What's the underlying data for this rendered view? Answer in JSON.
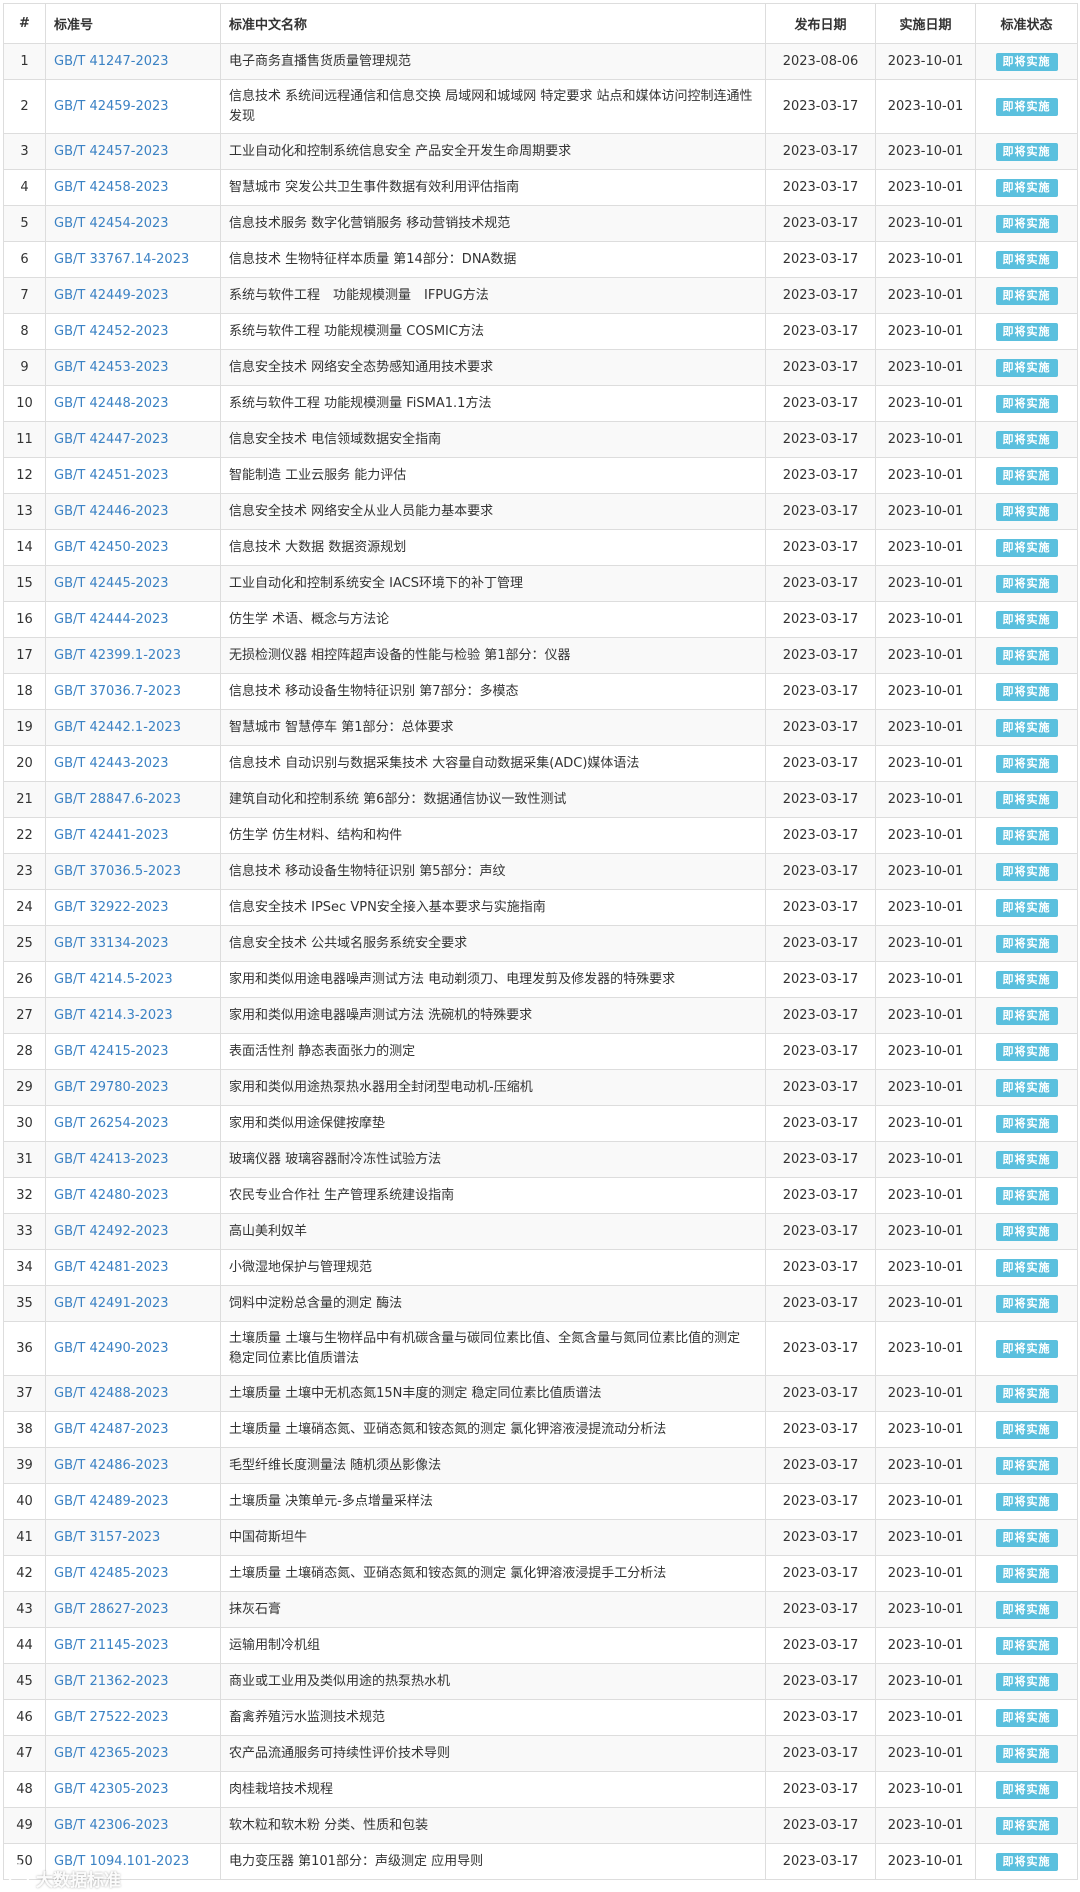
{
  "table": {
    "headers": [
      "#",
      "标准号",
      "标准中文名称",
      "发布日期",
      "实施日期",
      "标准状态"
    ],
    "rows": [
      {
        "no": "1",
        "code": "GB/T 41247-2023",
        "name": "电子商务直播售货质量管理规范",
        "published": "2023-08-06",
        "effective": "2023-10-01",
        "status": "即将实施"
      },
      {
        "no": "2",
        "code": "GB/T 42459-2023",
        "name": "信息技术 系统间远程通信和信息交换 局域网和城域网 特定要求 站点和媒体访问控制连通性发现",
        "published": "2023-03-17",
        "effective": "2023-10-01",
        "status": "即将实施"
      },
      {
        "no": "3",
        "code": "GB/T 42457-2023",
        "name": "工业自动化和控制系统信息安全 产品安全开发生命周期要求",
        "published": "2023-03-17",
        "effective": "2023-10-01",
        "status": "即将实施"
      },
      {
        "no": "4",
        "code": "GB/T 42458-2023",
        "name": "智慧城市 突发公共卫生事件数据有效利用评估指南",
        "published": "2023-03-17",
        "effective": "2023-10-01",
        "status": "即将实施"
      },
      {
        "no": "5",
        "code": "GB/T 42454-2023",
        "name": "信息技术服务 数字化营销服务 移动营销技术规范",
        "published": "2023-03-17",
        "effective": "2023-10-01",
        "status": "即将实施"
      },
      {
        "no": "6",
        "code": "GB/T 33767.14-2023",
        "name": "信息技术 生物特征样本质量 第14部分：DNA数据",
        "published": "2023-03-17",
        "effective": "2023-10-01",
        "status": "即将实施"
      },
      {
        "no": "7",
        "code": "GB/T 42449-2023",
        "name": "系统与软件工程　功能规模测量　IFPUG方法",
        "published": "2023-03-17",
        "effective": "2023-10-01",
        "status": "即将实施"
      },
      {
        "no": "8",
        "code": "GB/T 42452-2023",
        "name": "系统与软件工程 功能规模测量 COSMIC方法",
        "published": "2023-03-17",
        "effective": "2023-10-01",
        "status": "即将实施"
      },
      {
        "no": "9",
        "code": "GB/T 42453-2023",
        "name": "信息安全技术 网络安全态势感知通用技术要求",
        "published": "2023-03-17",
        "effective": "2023-10-01",
        "status": "即将实施"
      },
      {
        "no": "10",
        "code": "GB/T 42448-2023",
        "name": "系统与软件工程 功能规模测量 FiSMA1.1方法",
        "published": "2023-03-17",
        "effective": "2023-10-01",
        "status": "即将实施"
      },
      {
        "no": "11",
        "code": "GB/T 42447-2023",
        "name": "信息安全技术 电信领域数据安全指南",
        "published": "2023-03-17",
        "effective": "2023-10-01",
        "status": "即将实施"
      },
      {
        "no": "12",
        "code": "GB/T 42451-2023",
        "name": "智能制造 工业云服务 能力评估",
        "published": "2023-03-17",
        "effective": "2023-10-01",
        "status": "即将实施"
      },
      {
        "no": "13",
        "code": "GB/T 42446-2023",
        "name": "信息安全技术 网络安全从业人员能力基本要求",
        "published": "2023-03-17",
        "effective": "2023-10-01",
        "status": "即将实施"
      },
      {
        "no": "14",
        "code": "GB/T 42450-2023",
        "name": "信息技术 大数据 数据资源规划",
        "published": "2023-03-17",
        "effective": "2023-10-01",
        "status": "即将实施"
      },
      {
        "no": "15",
        "code": "GB/T 42445-2023",
        "name": "工业自动化和控制系统安全 IACS环境下的补丁管理",
        "published": "2023-03-17",
        "effective": "2023-10-01",
        "status": "即将实施"
      },
      {
        "no": "16",
        "code": "GB/T 42444-2023",
        "name": "仿生学 术语、概念与方法论",
        "published": "2023-03-17",
        "effective": "2023-10-01",
        "status": "即将实施"
      },
      {
        "no": "17",
        "code": "GB/T 42399.1-2023",
        "name": "无损检测仪器 相控阵超声设备的性能与检验 第1部分：仪器",
        "published": "2023-03-17",
        "effective": "2023-10-01",
        "status": "即将实施"
      },
      {
        "no": "18",
        "code": "GB/T 37036.7-2023",
        "name": "信息技术 移动设备生物特征识别 第7部分：多模态",
        "published": "2023-03-17",
        "effective": "2023-10-01",
        "status": "即将实施"
      },
      {
        "no": "19",
        "code": "GB/T 42442.1-2023",
        "name": "智慧城市 智慧停车 第1部分：总体要求",
        "published": "2023-03-17",
        "effective": "2023-10-01",
        "status": "即将实施"
      },
      {
        "no": "20",
        "code": "GB/T 42443-2023",
        "name": "信息技术 自动识别与数据采集技术 大容量自动数据采集(ADC)媒体语法",
        "published": "2023-03-17",
        "effective": "2023-10-01",
        "status": "即将实施"
      },
      {
        "no": "21",
        "code": "GB/T 28847.6-2023",
        "name": "建筑自动化和控制系统 第6部分：数据通信协议一致性测试",
        "published": "2023-03-17",
        "effective": "2023-10-01",
        "status": "即将实施"
      },
      {
        "no": "22",
        "code": "GB/T 42441-2023",
        "name": "仿生学 仿生材料、结构和构件",
        "published": "2023-03-17",
        "effective": "2023-10-01",
        "status": "即将实施"
      },
      {
        "no": "23",
        "code": "GB/T 37036.5-2023",
        "name": "信息技术 移动设备生物特征识别 第5部分：声纹",
        "published": "2023-03-17",
        "effective": "2023-10-01",
        "status": "即将实施"
      },
      {
        "no": "24",
        "code": "GB/T 32922-2023",
        "name": "信息安全技术 IPSec VPN安全接入基本要求与实施指南",
        "published": "2023-03-17",
        "effective": "2023-10-01",
        "status": "即将实施"
      },
      {
        "no": "25",
        "code": "GB/T 33134-2023",
        "name": "信息安全技术 公共域名服务系统安全要求",
        "published": "2023-03-17",
        "effective": "2023-10-01",
        "status": "即将实施"
      },
      {
        "no": "26",
        "code": "GB/T 4214.5-2023",
        "name": "家用和类似用途电器噪声测试方法 电动剃须刀、电理发剪及修发器的特殊要求",
        "published": "2023-03-17",
        "effective": "2023-10-01",
        "status": "即将实施"
      },
      {
        "no": "27",
        "code": "GB/T 4214.3-2023",
        "name": "家用和类似用途电器噪声测试方法 洗碗机的特殊要求",
        "published": "2023-03-17",
        "effective": "2023-10-01",
        "status": "即将实施"
      },
      {
        "no": "28",
        "code": "GB/T 42415-2023",
        "name": "表面活性剂 静态表面张力的测定",
        "published": "2023-03-17",
        "effective": "2023-10-01",
        "status": "即将实施"
      },
      {
        "no": "29",
        "code": "GB/T 29780-2023",
        "name": "家用和类似用途热泵热水器用全封闭型电动机-压缩机",
        "published": "2023-03-17",
        "effective": "2023-10-01",
        "status": "即将实施"
      },
      {
        "no": "30",
        "code": "GB/T 26254-2023",
        "name": "家用和类似用途保健按摩垫",
        "published": "2023-03-17",
        "effective": "2023-10-01",
        "status": "即将实施"
      },
      {
        "no": "31",
        "code": "GB/T 42413-2023",
        "name": "玻璃仪器 玻璃容器耐冷冻性试验方法",
        "published": "2023-03-17",
        "effective": "2023-10-01",
        "status": "即将实施"
      },
      {
        "no": "32",
        "code": "GB/T 42480-2023",
        "name": "农民专业合作社 生产管理系统建设指南",
        "published": "2023-03-17",
        "effective": "2023-10-01",
        "status": "即将实施"
      },
      {
        "no": "33",
        "code": "GB/T 42492-2023",
        "name": "高山美利奴羊",
        "published": "2023-03-17",
        "effective": "2023-10-01",
        "status": "即将实施"
      },
      {
        "no": "34",
        "code": "GB/T 42481-2023",
        "name": "小微湿地保护与管理规范",
        "published": "2023-03-17",
        "effective": "2023-10-01",
        "status": "即将实施"
      },
      {
        "no": "35",
        "code": "GB/T 42491-2023",
        "name": "饲料中淀粉总含量的测定 酶法",
        "published": "2023-03-17",
        "effective": "2023-10-01",
        "status": "即将实施"
      },
      {
        "no": "36",
        "code": "GB/T 42490-2023",
        "name": "土壤质量 土壤与生物样品中有机碳含量与碳同位素比值、全氮含量与氮同位素比值的测定 稳定同位素比值质谱法",
        "published": "2023-03-17",
        "effective": "2023-10-01",
        "status": "即将实施"
      },
      {
        "no": "37",
        "code": "GB/T 42488-2023",
        "name": "土壤质量 土壤中无机态氮15N丰度的测定 稳定同位素比值质谱法",
        "published": "2023-03-17",
        "effective": "2023-10-01",
        "status": "即将实施"
      },
      {
        "no": "38",
        "code": "GB/T 42487-2023",
        "name": "土壤质量 土壤硝态氮、亚硝态氮和铵态氮的测定 氯化钾溶液浸提流动分析法",
        "published": "2023-03-17",
        "effective": "2023-10-01",
        "status": "即将实施"
      },
      {
        "no": "39",
        "code": "GB/T 42486-2023",
        "name": "毛型纤维长度测量法 随机须丛影像法",
        "published": "2023-03-17",
        "effective": "2023-10-01",
        "status": "即将实施"
      },
      {
        "no": "40",
        "code": "GB/T 42489-2023",
        "name": "土壤质量 决策单元-多点增量采样法",
        "published": "2023-03-17",
        "effective": "2023-10-01",
        "status": "即将实施"
      },
      {
        "no": "41",
        "code": "GB/T 3157-2023",
        "name": "中国荷斯坦牛",
        "published": "2023-03-17",
        "effective": "2023-10-01",
        "status": "即将实施"
      },
      {
        "no": "42",
        "code": "GB/T 42485-2023",
        "name": "土壤质量 土壤硝态氮、亚硝态氮和铵态氮的测定 氯化钾溶液浸提手工分析法",
        "published": "2023-03-17",
        "effective": "2023-10-01",
        "status": "即将实施"
      },
      {
        "no": "43",
        "code": "GB/T 28627-2023",
        "name": "抹灰石膏",
        "published": "2023-03-17",
        "effective": "2023-10-01",
        "status": "即将实施"
      },
      {
        "no": "44",
        "code": "GB/T 21145-2023",
        "name": "运输用制冷机组",
        "published": "2023-03-17",
        "effective": "2023-10-01",
        "status": "即将实施"
      },
      {
        "no": "45",
        "code": "GB/T 21362-2023",
        "name": "商业或工业用及类似用途的热泵热水机",
        "published": "2023-03-17",
        "effective": "2023-10-01",
        "status": "即将实施"
      },
      {
        "no": "46",
        "code": "GB/T 27522-2023",
        "name": "畜禽养殖污水监测技术规范",
        "published": "2023-03-17",
        "effective": "2023-10-01",
        "status": "即将实施"
      },
      {
        "no": "47",
        "code": "GB/T 42365-2023",
        "name": "农产品流通服务可持续性评价技术导则",
        "published": "2023-03-17",
        "effective": "2023-10-01",
        "status": "即将实施"
      },
      {
        "no": "48",
        "code": "GB/T 42305-2023",
        "name": "肉桂栽培技术规程",
        "published": "2023-03-17",
        "effective": "2023-10-01",
        "status": "即将实施"
      },
      {
        "no": "49",
        "code": "GB/T 42306-2023",
        "name": "软木粒和软木粉 分类、性质和包装",
        "published": "2023-03-17",
        "effective": "2023-10-01",
        "status": "即将实施"
      },
      {
        "no": "50",
        "code": "GB/T 1094.101-2023",
        "name": "电力变压器 第101部分：声级测定 应用导则",
        "published": "2023-03-17",
        "effective": "2023-10-01",
        "status": "即将实施"
      }
    ]
  },
  "watermark": {
    "text": "大数据标准",
    "icon": "weibo-logo-icon"
  }
}
